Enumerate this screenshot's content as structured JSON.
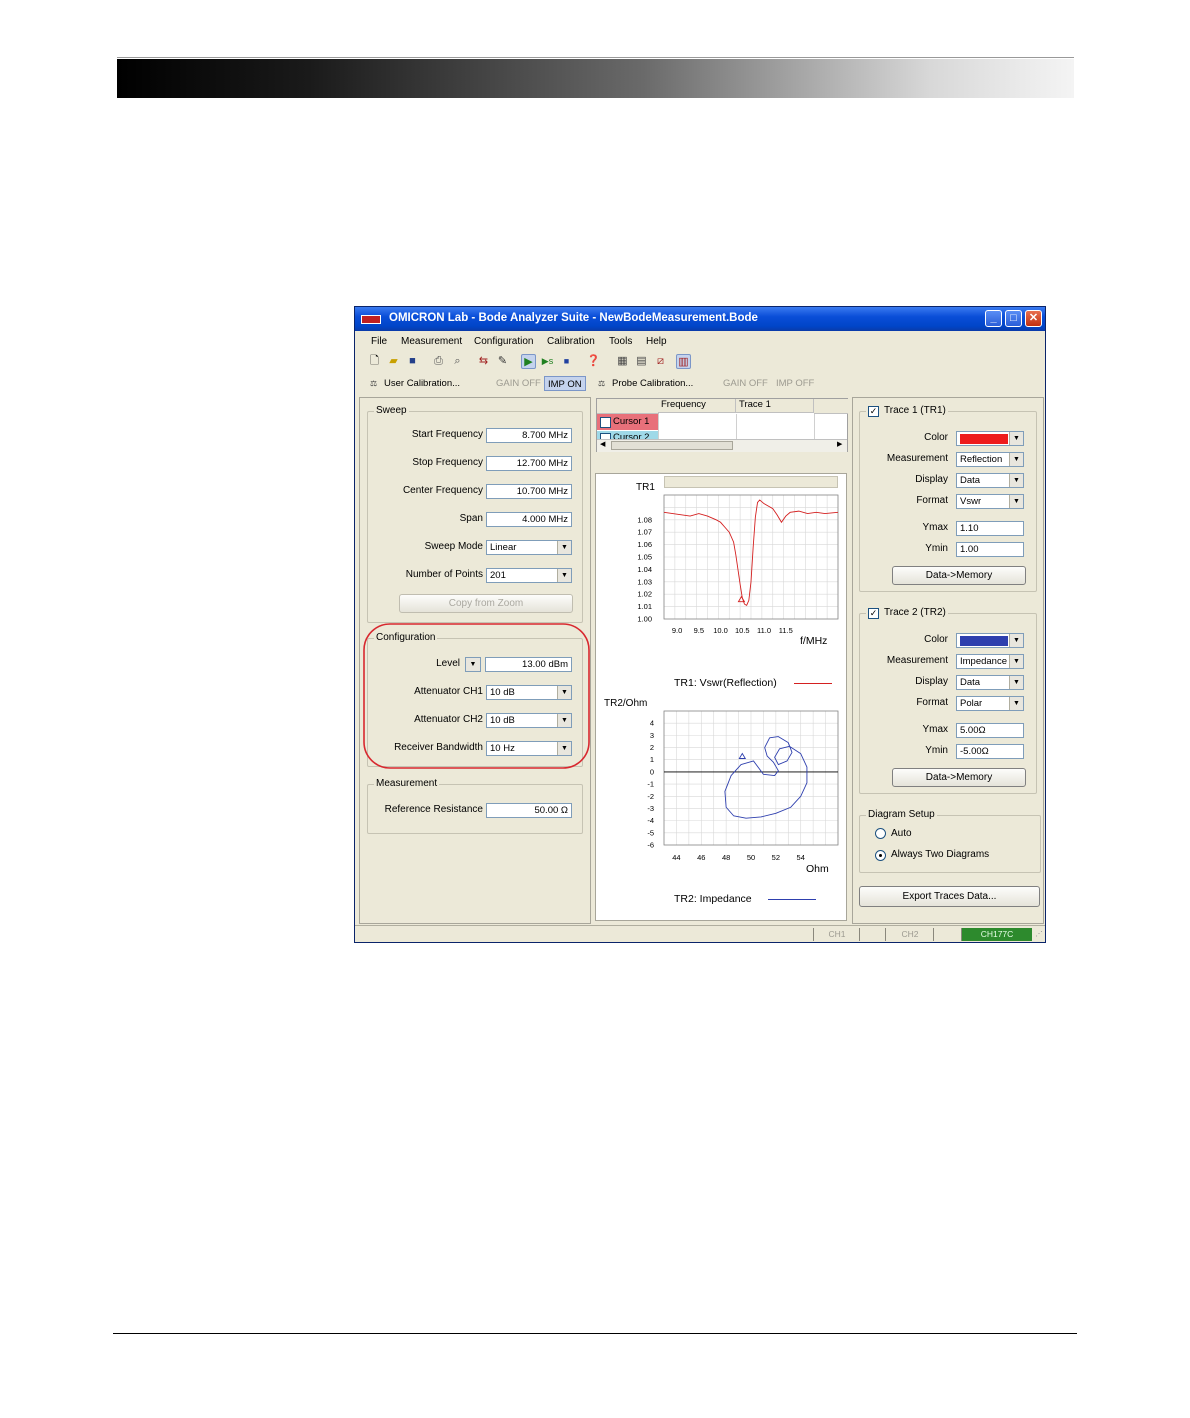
{
  "window": {
    "title": "OMICRON Lab - Bode Analyzer Suite - NewBodeMeasurement.Bode",
    "minimize_icon": "minimize-icon",
    "maximize_icon": "maximize-icon",
    "close_icon": "close-icon"
  },
  "menu": [
    "File",
    "Measurement",
    "Configuration",
    "Calibration",
    "Tools",
    "Help"
  ],
  "toolbar_icons": [
    "new-file-icon",
    "open-folder-icon",
    "save-icon",
    "print-icon",
    "print-preview-icon",
    "connect-icon",
    "wrench-icon",
    "play-icon",
    "single-sweep-icon",
    "stop-icon",
    "help-icon",
    "layout-icon",
    "layout-icon",
    "chart-icon",
    "chart-icon"
  ],
  "calbar": {
    "user_cal": "User Calibration...",
    "gain_off_1": "GAIN OFF",
    "imp_on": "IMP ON",
    "probe_cal": "Probe Calibration...",
    "gain_off_2": "GAIN OFF",
    "imp_off": "IMP OFF"
  },
  "sweep": {
    "title": "Sweep",
    "start_label": "Start Frequency",
    "start_value": "8.700 MHz",
    "stop_label": "Stop Frequency",
    "stop_value": "12.700 MHz",
    "center_label": "Center Frequency",
    "center_value": "10.700 MHz",
    "span_label": "Span",
    "span_value": "4.000 MHz",
    "mode_label": "Sweep Mode",
    "mode_value": "Linear",
    "points_label": "Number of Points",
    "points_value": "201",
    "copy_zoom": "Copy from Zoom"
  },
  "configuration": {
    "title": "Configuration",
    "level_label": "Level",
    "level_value": "13.00 dBm",
    "att1_label": "Attenuator CH1",
    "att1_value": "10 dB",
    "att2_label": "Attenuator CH2",
    "att2_value": "10 dB",
    "rbw_label": "Receiver Bandwidth",
    "rbw_value": "10 Hz"
  },
  "measurement": {
    "title": "Measurement",
    "ref_label": "Reference Resistance",
    "ref_value": "50.00 Ω"
  },
  "cursor_table": {
    "headers": [
      "Frequency",
      "Trace 1"
    ],
    "cursor1": "Cursor 1",
    "cursor2": "Cursor 2"
  },
  "trace1": {
    "title": "Trace 1 (TR1)",
    "color_label": "Color",
    "color": "#ee1c1c",
    "meas_label": "Measurement",
    "meas_value": "Reflection",
    "display_label": "Display",
    "display_value": "Data",
    "format_label": "Format",
    "format_value": "Vswr",
    "ymax_label": "Ymax",
    "ymax_value": "1.10",
    "ymin_label": "Ymin",
    "ymin_value": "1.00",
    "button": "Data->Memory"
  },
  "trace2": {
    "title": "Trace 2 (TR2)",
    "color_label": "Color",
    "color": "#2e3fae",
    "meas_label": "Measurement",
    "meas_value": "Impedance",
    "display_label": "Display",
    "display_value": "Data",
    "format_label": "Format",
    "format_value": "Polar",
    "ymax_label": "Ymax",
    "ymax_value": "5.00Ω",
    "ymin_label": "Ymin",
    "ymin_value": "-5.00Ω",
    "button": "Data->Memory"
  },
  "diagram_setup": {
    "title": "Diagram Setup",
    "auto": "Auto",
    "two": "Always Two Diagrams"
  },
  "export_button": "Export Traces Data...",
  "status": {
    "ch1": "CH1",
    "ch2": "CH2",
    "device": "CH177C"
  },
  "chart_data": [
    {
      "type": "line",
      "ylabel": "TR1",
      "xlabel": "f/MHz",
      "xlim": [
        8.7,
        12.7
      ],
      "ylim": [
        1.0,
        1.1
      ],
      "x_ticks": [
        "9.0",
        "9.5",
        "10.0",
        "10.5",
        "11.0",
        "11.5"
      ],
      "y_ticks": [
        "1.08",
        "1.07",
        "1.06",
        "1.05",
        "1.04",
        "1.03",
        "1.02",
        "1.01",
        "1.00"
      ],
      "legend": "TR1: Vswr(Reflection)",
      "series": [
        {
          "name": "TR1: Vswr(Reflection)",
          "color": "#d42020",
          "x": [
            8.7,
            8.9,
            9.1,
            9.3,
            9.5,
            9.7,
            9.9,
            10.0,
            10.1,
            10.2,
            10.3,
            10.35,
            10.4,
            10.45,
            10.5,
            10.55,
            10.6,
            10.65,
            10.7,
            10.75,
            10.8,
            10.85,
            10.9,
            11.0,
            11.1,
            11.2,
            11.3,
            11.4,
            11.5,
            11.6,
            11.8,
            12.0,
            12.2,
            12.4,
            12.7
          ],
          "y": [
            1.086,
            1.085,
            1.084,
            1.083,
            1.085,
            1.083,
            1.08,
            1.078,
            1.074,
            1.07,
            1.062,
            1.052,
            1.04,
            1.028,
            1.017,
            1.012,
            1.011,
            1.015,
            1.03,
            1.058,
            1.082,
            1.094,
            1.096,
            1.093,
            1.091,
            1.089,
            1.084,
            1.078,
            1.083,
            1.086,
            1.087,
            1.085,
            1.086,
            1.085,
            1.086
          ]
        }
      ]
    },
    {
      "type": "scatter",
      "ylabel": "TR2/Ohm",
      "xlabel": "Ohm",
      "xlim": [
        43,
        57
      ],
      "ylim": [
        -6,
        5
      ],
      "x_ticks": [
        "44",
        "46",
        "48",
        "50",
        "52",
        "54"
      ],
      "y_ticks": [
        "4",
        "3",
        "2",
        "1",
        "0",
        "-1",
        "-2",
        "-3",
        "-4",
        "-5",
        "-6"
      ],
      "legend": "TR2: Impedance",
      "series": [
        {
          "name": "TR2: Impedance",
          "color": "#2e3fae",
          "x": [
            50.2,
            49.2,
            48.4,
            47.9,
            48.0,
            48.6,
            49.6,
            50.8,
            52.0,
            53.2,
            54.0,
            54.5,
            54.5,
            54.0,
            53.1,
            52.3,
            51.9,
            52.2,
            52.9,
            53.3,
            53.0,
            52.2,
            51.5,
            51.1,
            51.3,
            51.8,
            52.2,
            51.9,
            51.0,
            50.2
          ],
          "y": [
            0.9,
            0.6,
            -0.3,
            -1.6,
            -2.9,
            -3.6,
            -3.8,
            -3.7,
            -3.4,
            -2.9,
            -2.0,
            -0.9,
            0.4,
            1.5,
            2.1,
            1.9,
            1.2,
            0.6,
            0.9,
            1.6,
            2.4,
            2.9,
            2.8,
            2.0,
            1.3,
            0.8,
            0.1,
            -0.3,
            -0.2,
            0.9
          ]
        }
      ]
    }
  ]
}
